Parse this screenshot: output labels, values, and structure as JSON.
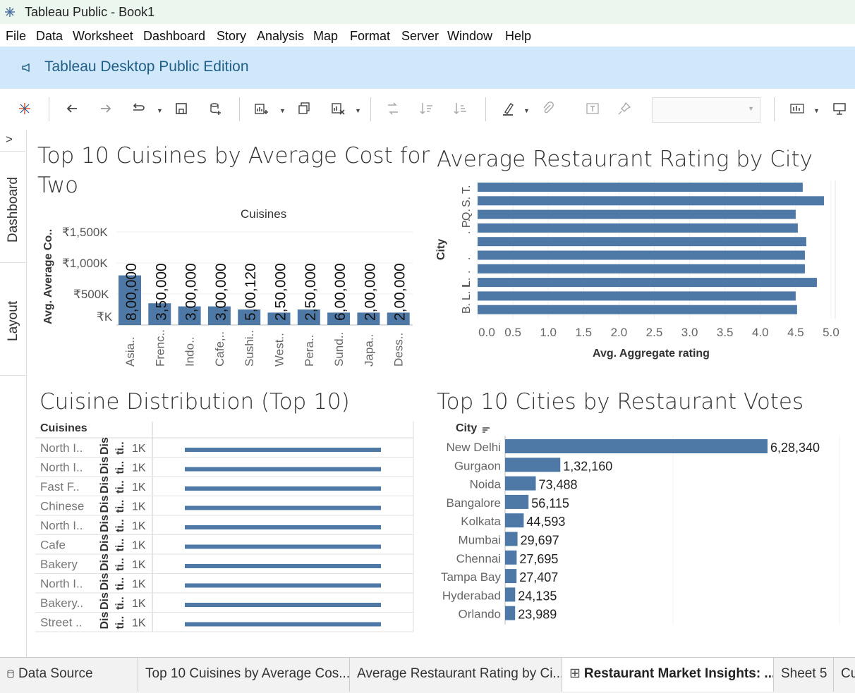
{
  "window": {
    "title": "Tableau Public - Book1"
  },
  "menu": [
    "File",
    "Data",
    "Worksheet",
    "Dashboard",
    "Story",
    "Analysis",
    "Map",
    "Format",
    "Server",
    "Window",
    "Help"
  ],
  "banner": {
    "text": "Tableau Desktop Public Edition"
  },
  "sidebar": {
    "collapse": ">",
    "tabs": [
      "Dashboard",
      "Layout"
    ]
  },
  "colors": {
    "bar": "#4e79a7",
    "banner_bg": "#d1e7fa",
    "banner_text": "#1f5e86"
  },
  "sheets": [
    {
      "title": "Top 10 Cuisines by Average Cost for Two",
      "title_line1": "Top 10 Cuisines by Average Cost for",
      "title_line2": "Two",
      "chart_data": {
        "type": "bar",
        "column_header": "Cuisines",
        "ylabel": "Avg. Average Co..",
        "yticks": [
          "₹1,500K",
          "₹1,000K",
          "₹500K",
          "₹K"
        ],
        "ylim": [
          0,
          1500000
        ],
        "categories": [
          "Asia..",
          "Frenc..",
          "Indo..",
          "Cafe,..",
          "Sushi..",
          "West..",
          "Pera..",
          "Sund..",
          "Japa..",
          "Dess.."
        ],
        "values": [
          800000,
          350000,
          300000,
          300000,
          250000,
          200000,
          250000,
          200000,
          200000,
          200000
        ],
        "labels": [
          "8,00,000",
          "3,50,000",
          "3,00,000",
          "3,00,000",
          "5,00,120",
          "2,50,000",
          "2,50,000",
          "6,00,000",
          "2,00,000",
          "2,00,000"
        ]
      }
    },
    {
      "title": "Average Restaurant Rating by City",
      "chart_data": {
        "type": "bar",
        "orientation": "horizontal",
        "ylabel": "City",
        "city_labels": [
          "B.",
          "L. I.",
          "L.",
          ".",
          ".",
          "",
          ". P.",
          "Q.",
          "S.",
          "T."
        ],
        "values": [
          4.6,
          4.9,
          4.5,
          4.53,
          4.65,
          4.63,
          4.63,
          4.8,
          4.5,
          4.52
        ],
        "xlabel": "Avg. Aggregate rating",
        "xticks": [
          "0.0",
          "0.5",
          "1.0",
          "1.5",
          "2.0",
          "2.5",
          "3.0",
          "3.5",
          "4.0",
          "4.5",
          "5.0"
        ],
        "xlim": [
          0,
          5
        ]
      }
    },
    {
      "title": "Cuisine Distribution (Top 10)",
      "chart_data": {
        "type": "bar",
        "orientation": "horizontal",
        "column_header": "Cuisines",
        "rows": [
          "North I..",
          "North I..",
          "Fast F..",
          "Chinese",
          "North I..",
          "Cafe",
          "Bakery",
          "North I..",
          "Bakery..",
          "Street .."
        ],
        "col2": [
          "Dis",
          "Dis",
          "Dis",
          "Dis",
          "Dis",
          "Dis",
          "Dis",
          "Dis",
          "Dis",
          "Dis"
        ],
        "col3": [
          "ti..",
          "ti..",
          "ti..",
          "ti..",
          "ti..",
          "ti..",
          "ti..",
          "ti..",
          "ti..",
          "ti.."
        ],
        "col4": [
          "1K",
          "1K",
          "1K",
          "1K",
          "1K",
          "1K",
          "1K",
          "1K",
          "1K",
          "1K"
        ],
        "values": [
          1,
          1,
          1,
          1,
          1,
          1,
          1,
          1,
          1,
          1
        ]
      }
    },
    {
      "title": "Top 10 Cities by Restaurant Votes",
      "chart_data": {
        "type": "bar",
        "orientation": "horizontal",
        "column_header": "City",
        "categories": [
          "New Delhi",
          "Gurgaon",
          "Noida",
          "Bangalore",
          "Kolkata",
          "Mumbai",
          "Chennai",
          "Tampa Bay",
          "Hyderabad",
          "Orlando"
        ],
        "values": [
          628340,
          132160,
          73488,
          56115,
          44593,
          29697,
          27695,
          27407,
          24135,
          23989
        ],
        "labels": [
          "6,28,340",
          "1,32,160",
          "73,488",
          "56,115",
          "44,593",
          "29,697",
          "27,695",
          "27,407",
          "24,135",
          "23,989"
        ]
      }
    }
  ],
  "bottom_tabs": [
    "Data Source",
    "Top 10 Cuisines by Average Cos...",
    "Average Restaurant Rating by Ci...",
    "Restaurant Market Insights: ...",
    "Sheet 5",
    "Cu"
  ]
}
